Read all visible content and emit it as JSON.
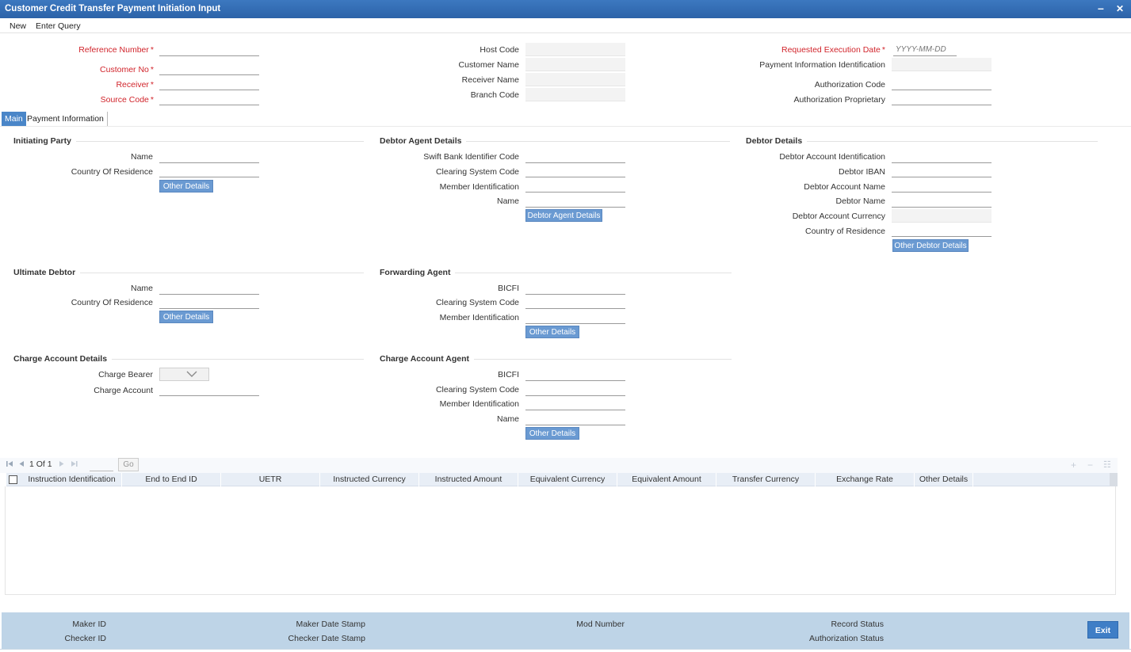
{
  "window": {
    "title": "Customer Credit Transfer Payment Initiation Input",
    "minimize": "–",
    "close": "✕"
  },
  "menu": {
    "new": "New",
    "enter_query": "Enter Query"
  },
  "header": {
    "reference_number": "Reference Number",
    "customer_no": "Customer No",
    "receiver": "Receiver",
    "source_code": "Source Code",
    "host_code": "Host Code",
    "customer_name": "Customer Name",
    "receiver_name": "Receiver Name",
    "branch_code": "Branch Code",
    "requested_execution_date": "Requested Execution Date",
    "date_placeholder": "YYYY-MM-DD",
    "payment_information_identification": "Payment Information Identification",
    "authorization_code": "Authorization Code",
    "authorization_proprietary": "Authorization Proprietary",
    "required_mark": "*"
  },
  "tabs": {
    "main": "Main",
    "payment_information": "Payment Information"
  },
  "initiating_party": {
    "title": "Initiating Party",
    "name": "Name",
    "country_of_residence": "Country Of Residence",
    "other_details": "Other Details"
  },
  "debtor_agent": {
    "title": "Debtor Agent Details",
    "swift_bic": "Swift Bank Identifier Code",
    "clearing_system_code": "Clearing System Code",
    "member_identification": "Member Identification",
    "name": "Name",
    "button": "Debtor Agent Details"
  },
  "debtor_details": {
    "title": "Debtor Details",
    "account_identification": "Debtor Account Identification",
    "iban": "Debtor IBAN",
    "account_name": "Debtor Account Name",
    "debtor_name": "Debtor Name",
    "account_currency": "Debtor Account Currency",
    "country_of_residence": "Country of Residence",
    "button": "Other Debtor Details"
  },
  "ultimate_debtor": {
    "title": "Ultimate Debtor",
    "name": "Name",
    "country_of_residence": "Country Of Residence",
    "other_details": "Other Details"
  },
  "forwarding_agent": {
    "title": "Forwarding Agent",
    "bicfi": "BICFI",
    "clearing_system_code": "Clearing System Code",
    "member_identification": "Member Identification",
    "other_details": "Other Details"
  },
  "charge_account_details": {
    "title": "Charge Account Details",
    "charge_bearer": "Charge Bearer",
    "charge_account": "Charge Account"
  },
  "charge_account_agent": {
    "title": "Charge Account Agent",
    "bicfi": "BICFI",
    "clearing_system_code": "Clearing System Code",
    "member_identification": "Member Identification",
    "name": "Name",
    "other_details": "Other Details"
  },
  "grid": {
    "page_info": "1 Of 1",
    "go": "Go",
    "columns": [
      "Instruction Identification",
      "End to End ID",
      "UETR",
      "Instructed Currency",
      "Instructed Amount",
      "Equivalent Currency",
      "Equivalent Amount",
      "Transfer Currency",
      "Exchange Rate",
      "Other Details"
    ],
    "add": "+",
    "remove": "−",
    "view": "☷"
  },
  "footer": {
    "maker_id": "Maker ID",
    "checker_id": "Checker ID",
    "maker_date_stamp": "Maker Date Stamp",
    "checker_date_stamp": "Checker Date Stamp",
    "mod_number": "Mod Number",
    "record_status": "Record Status",
    "authorization_status": "Authorization Status",
    "exit": "Exit"
  }
}
